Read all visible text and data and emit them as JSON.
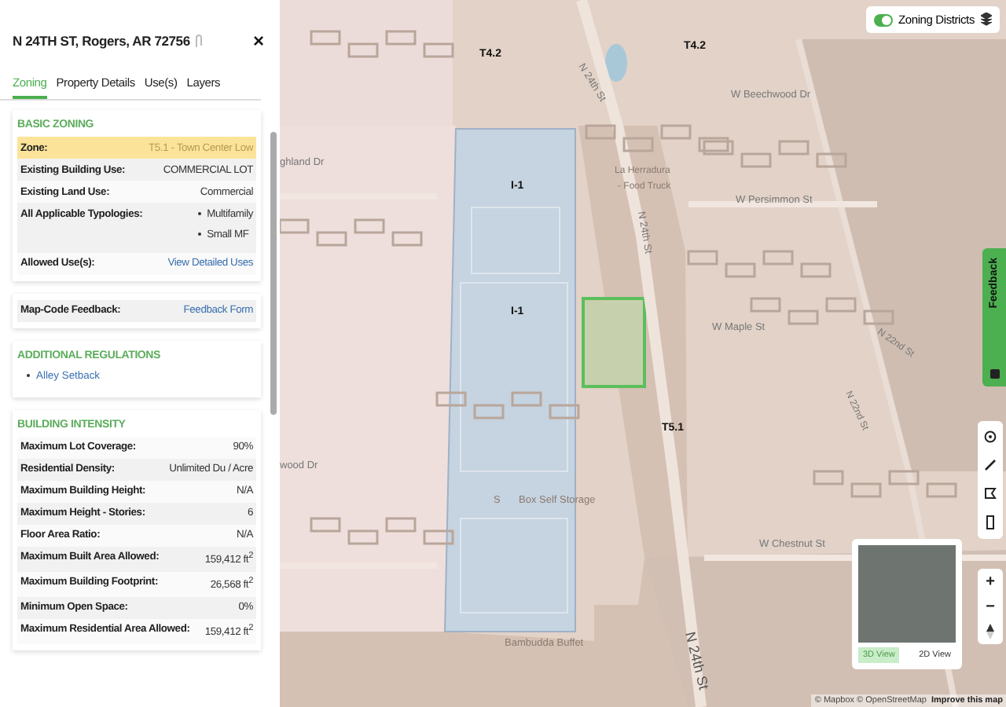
{
  "panel": {
    "title": "N 24TH ST, Rogers, AR 72756",
    "close": "×",
    "tabs": [
      {
        "label": "Zoning",
        "selected": true
      },
      {
        "label": "Property Details",
        "selected": false
      },
      {
        "label": "Use(s)",
        "selected": false
      },
      {
        "label": "Layers",
        "selected": false
      }
    ],
    "sections": [
      {
        "heading": "BASIC ZONING",
        "rows": [
          {
            "kind": "text",
            "label": "Zone:",
            "value": "T5.1 - Town Center Low",
            "highlighted": true
          },
          {
            "kind": "text",
            "label": "Existing Building Use:",
            "value": "COMMERCIAL LOT",
            "highlighted": false
          },
          {
            "kind": "text",
            "label": "Existing Land Use:",
            "value": "Commercial",
            "highlighted": false
          },
          {
            "kind": "list",
            "label": "All Applicable Typologies:",
            "items": [
              "Multifamily",
              "Small MF"
            ],
            "highlighted": false
          },
          {
            "kind": "link",
            "label": "Allowed Use(s):",
            "value": "View Detailed Uses",
            "highlighted": false
          }
        ]
      },
      {
        "rows": [
          {
            "kind": "link",
            "label": "Map-Code Feedback:",
            "value": "Feedback Form",
            "highlighted": false
          }
        ]
      },
      {
        "heading": "ADDITIONAL REGULATIONS",
        "links": [
          "Alley Setback"
        ]
      },
      {
        "heading": "BUILDING INTENSITY",
        "rows": [
          {
            "kind": "text",
            "label": "Maximum Lot Coverage:",
            "value": "90%",
            "highlighted": false
          },
          {
            "kind": "text",
            "label": "Residential Density:",
            "value": "Unlimited Du / Acre",
            "highlighted": false
          },
          {
            "kind": "text",
            "label": "Maximum Building Height:",
            "value": "N/A",
            "highlighted": false
          },
          {
            "kind": "text",
            "label": "Maximum Height - Stories:",
            "value": "6",
            "highlighted": false
          },
          {
            "kind": "text",
            "label": "Floor Area Ratio:",
            "value": "N/A",
            "highlighted": false
          },
          {
            "kind": "text",
            "label": "Maximum Built Area Allowed:",
            "value": "159,412 ft$^{2}$",
            "highlighted": false
          },
          {
            "kind": "text",
            "label": "Maximum Building Footprint:",
            "value": "26,568 ft$^{2}$",
            "highlighted": false
          },
          {
            "kind": "text",
            "label": "Minimum Open Space:",
            "value": "0%",
            "highlighted": false
          },
          {
            "kind": "text",
            "label": "Maximum Residential Area Allowed:",
            "value": "159,412 ft$^{2}$",
            "highlighted": false
          }
        ]
      }
    ]
  },
  "map": {
    "labels": [
      {
        "text": "T4.2",
        "kind": "zone"
      },
      {
        "text": "T4.2",
        "kind": "zone"
      },
      {
        "text": "N 24th St",
        "kind": "street"
      },
      {
        "text": "W Beechwood Dr",
        "kind": "street"
      },
      {
        "text": "ghland Dr",
        "kind": "street"
      },
      {
        "text": "La Herradura",
        "kind": "place"
      },
      {
        "text": "- Food Truck",
        "kind": "place"
      },
      {
        "text": "I-1",
        "kind": "zone"
      },
      {
        "text": "I-1",
        "kind": "zone"
      },
      {
        "text": "W Persimmon St",
        "kind": "street"
      },
      {
        "text": "N 24th St",
        "kind": "street"
      },
      {
        "text": "W Maple St",
        "kind": "street"
      },
      {
        "text": "N 22nd St",
        "kind": "street"
      },
      {
        "text": "N 22nd St",
        "kind": "street"
      },
      {
        "text": "T5.1",
        "kind": "zone"
      },
      {
        "text": "wood Dr",
        "kind": "street"
      },
      {
        "text": "S",
        "kind": "place"
      },
      {
        "text": "Box Self Storage",
        "kind": "place"
      },
      {
        "text": "W Chestnut St",
        "kind": "street"
      },
      {
        "text": "Bambudda Buffet",
        "kind": "place"
      },
      {
        "text": "N 24th St",
        "kind": "major"
      }
    ],
    "layer_toggle": {
      "label": "Zoning Districts",
      "on": true
    },
    "feedback": "Feedback",
    "zoom": {
      "in": "+",
      "out": "−"
    },
    "views": [
      {
        "label": "3D View",
        "selected": true
      },
      {
        "label": "2D View",
        "selected": false
      }
    ],
    "attribution": "© Mapbox © OpenStreetMap",
    "improve_link": "Improve this map"
  }
}
